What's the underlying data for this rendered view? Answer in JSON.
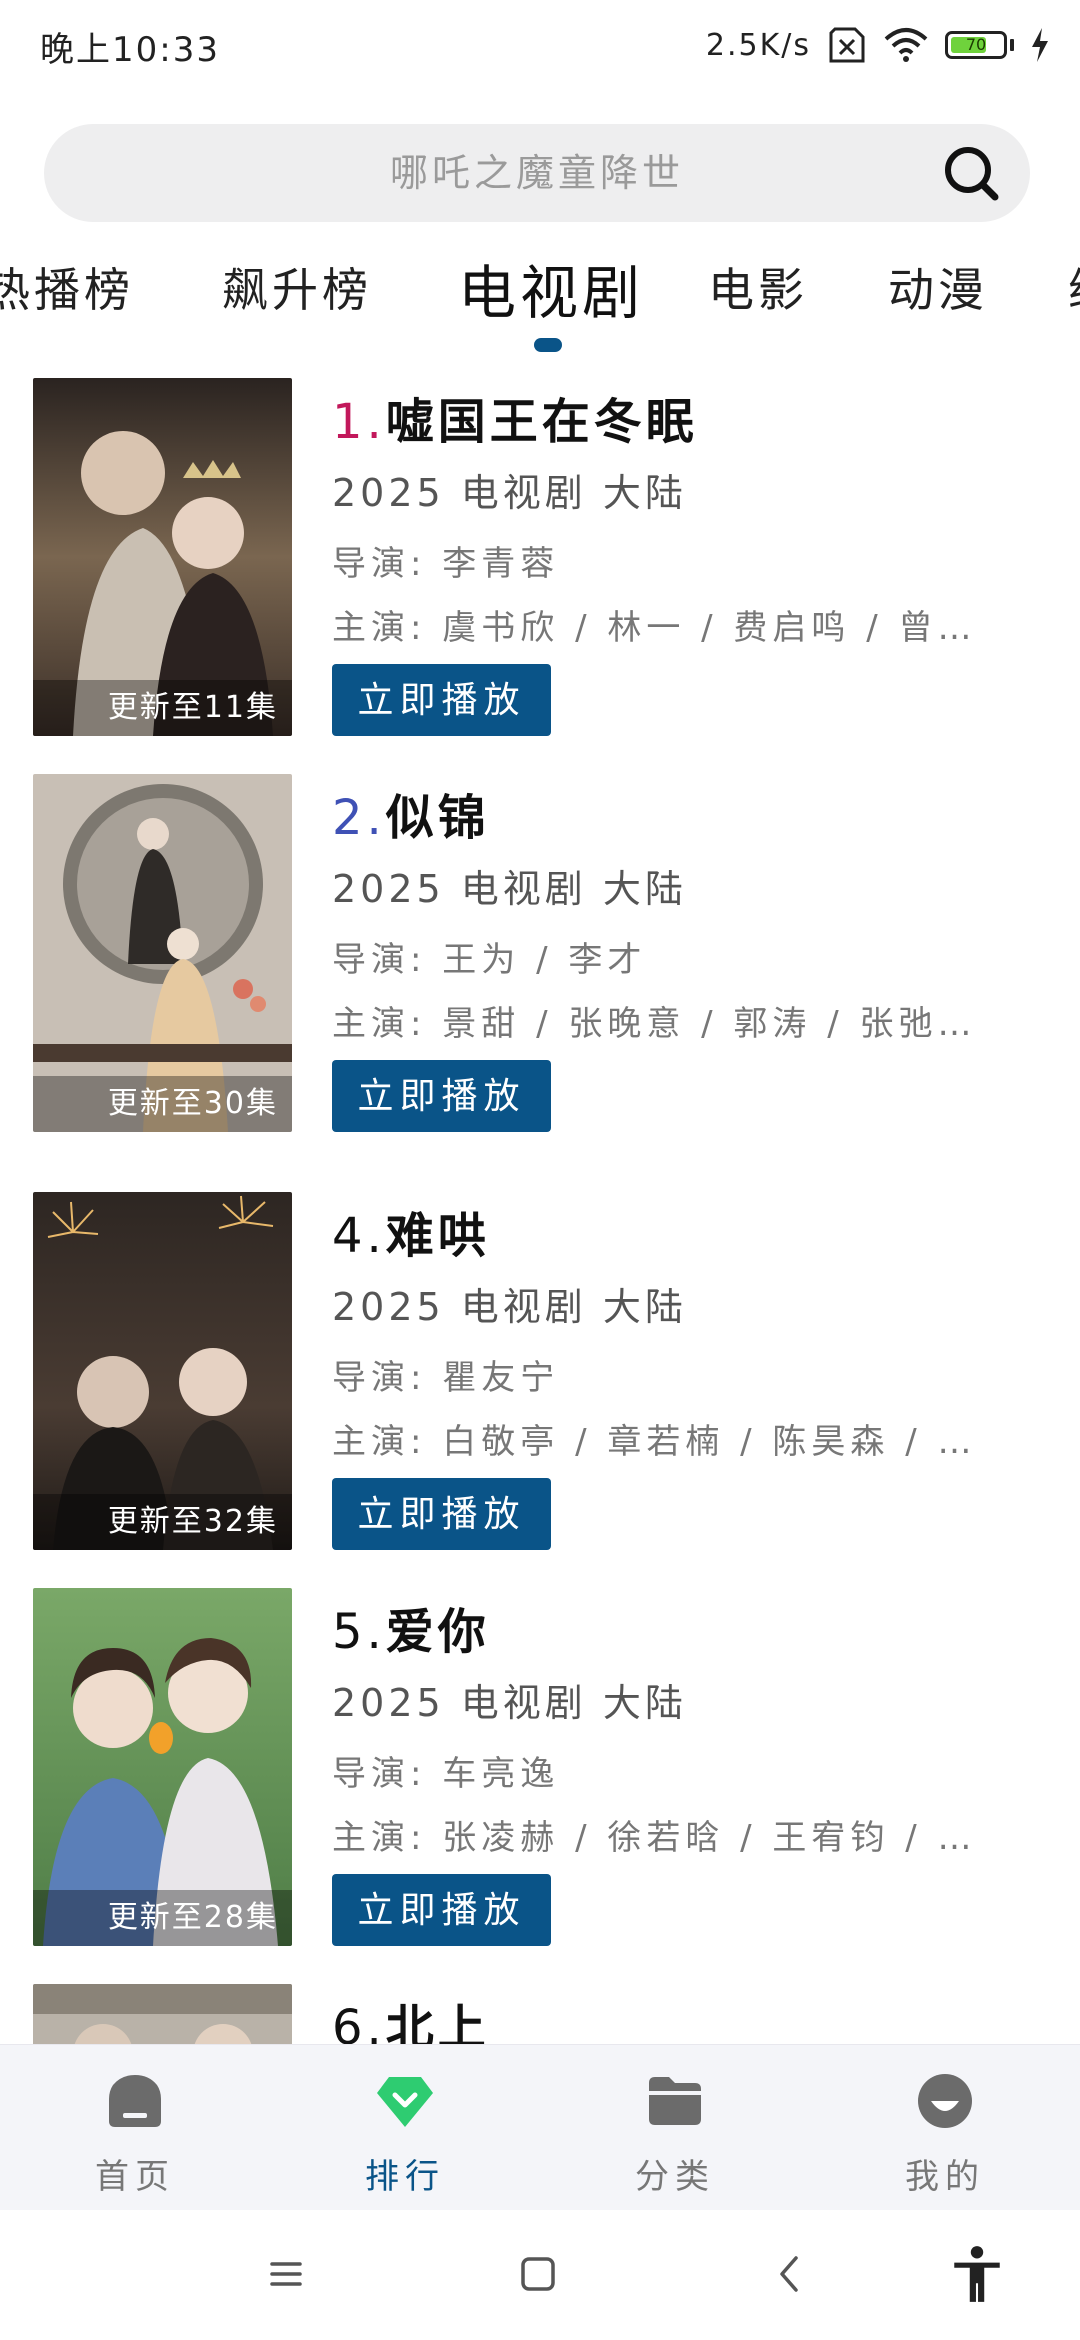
{
  "status_bar": {
    "time": "晚上10:33",
    "net_speed": "2.5K/s",
    "battery_level": "70",
    "battery_fraction": 0.7
  },
  "search": {
    "placeholder": "哪吒之魔童降世"
  },
  "tabs": [
    {
      "label": "热播榜"
    },
    {
      "label": "飙升榜"
    },
    {
      "label": "电视剧",
      "active": true
    },
    {
      "label": "电影"
    },
    {
      "label": "动漫"
    },
    {
      "label": "综"
    }
  ],
  "items": [
    {
      "rank": "1.",
      "rank_color": "#c2185b",
      "title": "嘘国王在冬眠",
      "meta": "2025 电视剧 大陆",
      "director": "导演: 李青蓉",
      "cast": "主演: 虞书欣 / 林一 / 费启鸣 / 曾…",
      "badge": "更新至11集",
      "play_label": "立即播放"
    },
    {
      "rank": "2.",
      "rank_color": "#3f51b5",
      "title": "似锦",
      "meta": "2025 电视剧 大陆",
      "director": "导演: 王为 / 李才",
      "cast": "主演: 景甜 / 张晚意 / 郭涛 / 张弛…",
      "badge": "更新至30集",
      "play_label": "立即播放"
    },
    {
      "rank": "4.",
      "rank_color": "#111111",
      "title": "难哄",
      "meta": "2025 电视剧 大陆",
      "director": "导演: 瞿友宁",
      "cast": "主演: 白敬亭 / 章若楠 / 陈昊森 / …",
      "badge": "更新至32集",
      "play_label": "立即播放"
    },
    {
      "rank": "5.",
      "rank_color": "#111111",
      "title": "爱你",
      "meta": "2025 电视剧 大陆",
      "director": "导演: 车亮逸",
      "cast": "主演: 张凌赫 / 徐若晗 / 王宥钧 / …",
      "badge": "更新至28集",
      "play_label": "立即播放"
    },
    {
      "rank": "6.",
      "rank_color": "#111111",
      "title": "北上",
      "meta": "",
      "director": "",
      "cast": "",
      "badge": "",
      "play_label": ""
    }
  ],
  "bottom_nav": [
    {
      "label": "首页",
      "icon": "home-icon"
    },
    {
      "label": "排行",
      "icon": "ranking-icon",
      "active": true
    },
    {
      "label": "分类",
      "icon": "folder-icon"
    },
    {
      "label": "我的",
      "icon": "profile-icon"
    }
  ],
  "colors": {
    "accent": "#0a5488",
    "ranking_icon": "#2ecc71",
    "nav_icon": "#6b6b6b"
  }
}
